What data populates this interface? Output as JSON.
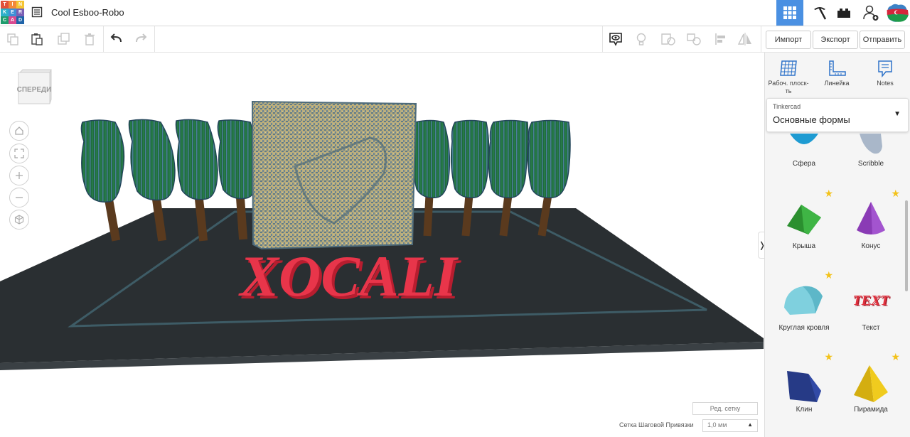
{
  "app": {
    "logo_letters": [
      "T",
      "I",
      "N",
      "K",
      "E",
      "R",
      "C",
      "A",
      "D"
    ],
    "logo_colors": [
      "#e2513b",
      "#f3883a",
      "#f5c432",
      "#2eb0c9",
      "#3f8fd6",
      "#7a5fb4",
      "#1f9c6d",
      "#d94a91",
      "#1e63a8"
    ],
    "title": "Cool Esboo-Robo"
  },
  "toolbar": {
    "import_label": "Импорт",
    "export_label": "Экспорт",
    "send_label": "Отправить"
  },
  "viewport": {
    "viewcube_label": "СПЕРЕДИ",
    "model_text": "XOCALI",
    "edit_grid_label": "Ред. сетку",
    "snap_label": "Сетка Шаговой Привязки",
    "snap_value": "1,0 мм"
  },
  "panel": {
    "tools": [
      {
        "label": "Рабоч. плоск-ть",
        "icon": "workplane-icon"
      },
      {
        "label": "Линейка",
        "icon": "ruler-icon"
      },
      {
        "label": "Notes",
        "icon": "notes-icon"
      }
    ],
    "library_source": "Tinkercad",
    "library_name": "Основные формы",
    "shapes": [
      {
        "label": "Сфера",
        "starred": false
      },
      {
        "label": "Scribble",
        "starred": false
      },
      {
        "label": "Крыша",
        "starred": true
      },
      {
        "label": "Конус",
        "starred": true
      },
      {
        "label": "Круглая кровля",
        "starred": true
      },
      {
        "label": "Текст",
        "starred": false
      },
      {
        "label": "Клин",
        "starred": true
      },
      {
        "label": "Пирамида",
        "starred": true
      }
    ],
    "shape_text_sample": "TEXT"
  },
  "colors": {
    "accent": "#4a90e2",
    "ground": "#2a2f32",
    "letters": "#d9263a",
    "foliage": "#1f6b3e",
    "trunk": "#5a3a1e"
  }
}
